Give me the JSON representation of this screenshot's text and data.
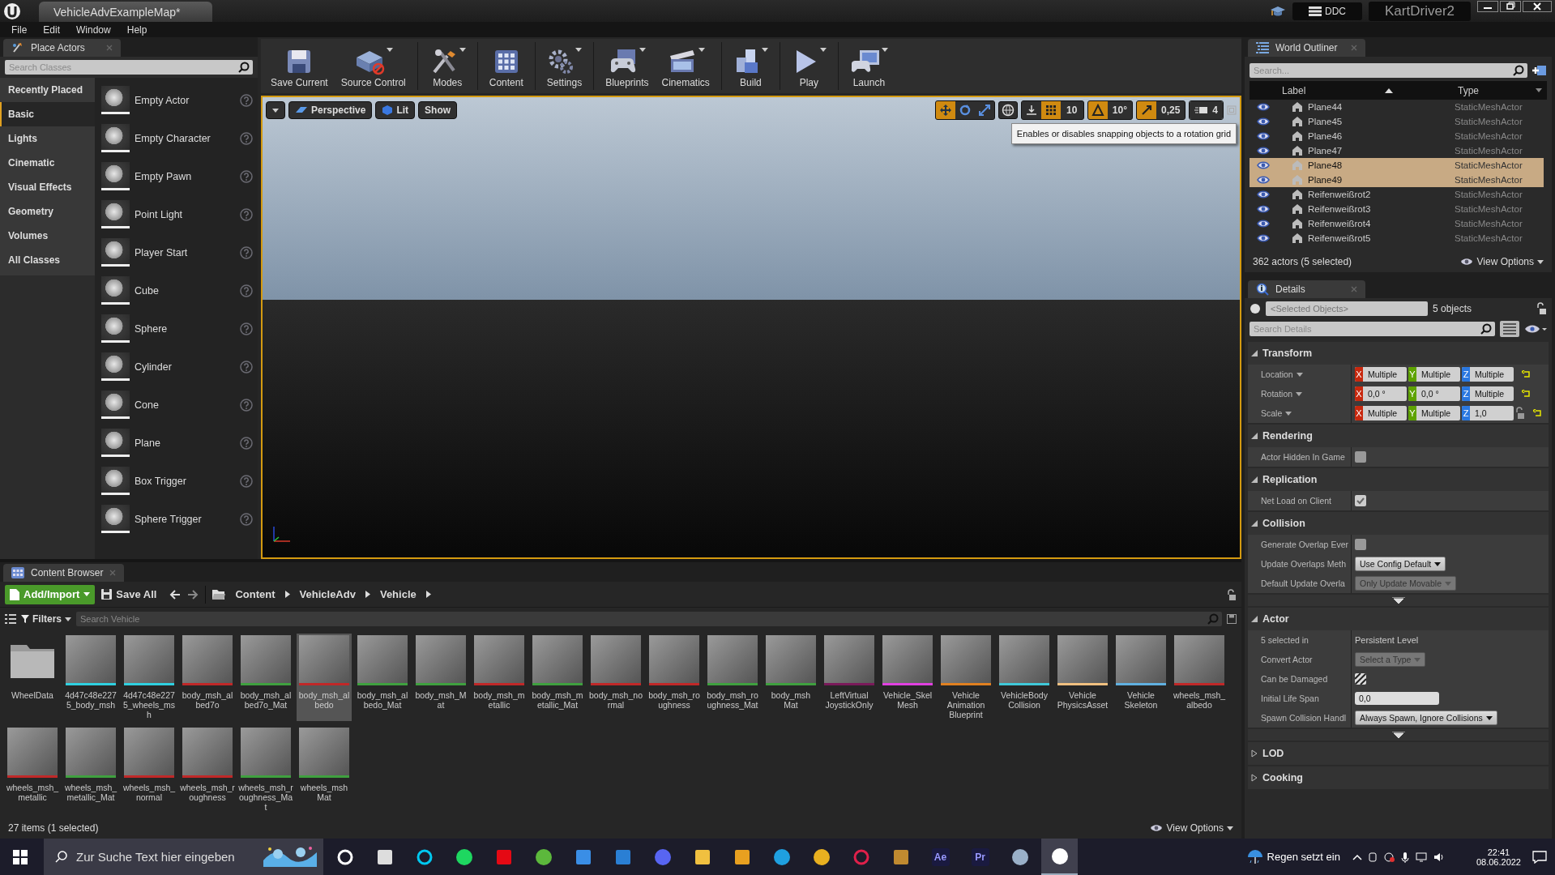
{
  "title_bar": {
    "document": "VehicleAdvExampleMap*",
    "ddc": "DDC",
    "project": "KartDriver2"
  },
  "menu": [
    "File",
    "Edit",
    "Window",
    "Help"
  ],
  "place_actors": {
    "title": "Place Actors",
    "search": {
      "placeholder": "Search Classes"
    },
    "categories": [
      {
        "label": "Recently Placed",
        "selected": false
      },
      {
        "label": "Basic",
        "selected": true
      },
      {
        "label": "Lights",
        "selected": false
      },
      {
        "label": "Cinematic",
        "selected": false
      },
      {
        "label": "Visual Effects",
        "selected": false
      },
      {
        "label": "Geometry",
        "selected": false
      },
      {
        "label": "Volumes",
        "selected": false
      },
      {
        "label": "All Classes",
        "selected": false
      }
    ],
    "items": [
      "Empty Actor",
      "Empty Character",
      "Empty Pawn",
      "Point Light",
      "Player Start",
      "Cube",
      "Sphere",
      "Cylinder",
      "Cone",
      "Plane",
      "Box Trigger",
      "Sphere Trigger"
    ]
  },
  "toolbar": [
    {
      "label": "Save Current",
      "dropdown": false
    },
    {
      "label": "Source Control",
      "dropdown": true
    },
    {
      "label": "Modes",
      "dropdown": true
    },
    {
      "label": "Content",
      "dropdown": false
    },
    {
      "label": "Settings",
      "dropdown": true
    },
    {
      "label": "Blueprints",
      "dropdown": true
    },
    {
      "label": "Cinematics",
      "dropdown": true
    },
    {
      "label": "Build",
      "dropdown": true
    },
    {
      "label": "Play",
      "dropdown": true
    },
    {
      "label": "Launch",
      "dropdown": true
    }
  ],
  "viewport": {
    "view_buttons": [
      "Perspective",
      "Lit",
      "Show"
    ],
    "transform_modes": [
      {
        "selected": true
      },
      {
        "selected": false
      },
      {
        "selected": false
      }
    ],
    "snaps": [
      {
        "value": "10",
        "on": true
      },
      {
        "value": "10°",
        "on": true
      },
      {
        "value": "0,25",
        "on": true
      }
    ],
    "camera_speed": "4",
    "tooltip": "Enables or disables snapping objects to a rotation grid"
  },
  "outliner": {
    "title": "World Outliner",
    "search": {
      "placeholder": "Search..."
    },
    "columns": [
      "Label",
      "Type"
    ],
    "rows": [
      {
        "label": "Plane44",
        "type": "StaticMeshActor",
        "selected": false
      },
      {
        "label": "Plane45",
        "type": "StaticMeshActor",
        "selected": false
      },
      {
        "label": "Plane46",
        "type": "StaticMeshActor",
        "selected": false
      },
      {
        "label": "Plane47",
        "type": "StaticMeshActor",
        "selected": false
      },
      {
        "label": "Plane48",
        "type": "StaticMeshActor",
        "selected": true
      },
      {
        "label": "Plane49",
        "type": "StaticMeshActor",
        "selected": true
      },
      {
        "label": "Reifenweißrot2",
        "type": "StaticMeshActor",
        "selected": false
      },
      {
        "label": "Reifenweißrot3",
        "type": "StaticMeshActor",
        "selected": false
      },
      {
        "label": "Reifenweißrot4",
        "type": "StaticMeshActor",
        "selected": false
      },
      {
        "label": "Reifenweißrot5",
        "type": "StaticMeshActor",
        "selected": false
      }
    ],
    "status": "362 actors (5 selected)",
    "view_options": "View Options"
  },
  "details": {
    "title": "Details",
    "selection": {
      "placeholder": "<Selected Objects>"
    },
    "count": "5 objects",
    "search": {
      "placeholder": "Search Details"
    },
    "sections": [
      {
        "title": "Transform",
        "expanded": true,
        "advanced": false,
        "rows": [
          {
            "kind": "vector",
            "label": "Location",
            "values": [
              {
                "axis": "X",
                "value": "Multiple"
              },
              {
                "axis": "Y",
                "value": "Multiple"
              },
              {
                "axis": "Z",
                "value": "Multiple"
              }
            ]
          },
          {
            "kind": "vector",
            "label": "Rotation",
            "values": [
              {
                "axis": "X",
                "value": "0,0 °"
              },
              {
                "axis": "Y",
                "value": "0,0 °"
              },
              {
                "axis": "Z",
                "value": "Multiple"
              }
            ]
          },
          {
            "kind": "vector",
            "label": "Scale",
            "values": [
              {
                "axis": "X",
                "value": "Multiple"
              },
              {
                "axis": "Y",
                "value": "Multiple"
              },
              {
                "axis": "Z",
                "value": "1,0"
              }
            ]
          }
        ]
      },
      {
        "title": "Rendering",
        "expanded": true,
        "advanced": false,
        "rows": [
          {
            "kind": "checkbox",
            "label": "Actor Hidden In Game",
            "checked": false,
            "mixed": false
          }
        ]
      },
      {
        "title": "Replication",
        "expanded": true,
        "advanced": false,
        "rows": [
          {
            "kind": "checkbox",
            "label": "Net Load on Client",
            "checked": true,
            "mixed": false
          }
        ]
      },
      {
        "title": "Collision",
        "expanded": true,
        "advanced": true,
        "rows": [
          {
            "kind": "checkbox",
            "label": "Generate Overlap Ever",
            "checked": false,
            "mixed": false
          },
          {
            "kind": "dropdown",
            "label": "Update Overlaps Meth",
            "value": "Use Config Default",
            "disabled": false
          },
          {
            "kind": "dropdown",
            "label": "Default Update Overla",
            "value": "Only Update Movable",
            "disabled": true
          }
        ]
      },
      {
        "title": "Actor",
        "expanded": true,
        "advanced": true,
        "rows": [
          {
            "kind": "text",
            "label": "5 selected in",
            "value": "Persistent Level"
          },
          {
            "kind": "dropdown",
            "label": "Convert Actor",
            "value": "Select a Type",
            "disabled": true
          },
          {
            "kind": "checkbox",
            "label": "Can be Damaged",
            "checked": true,
            "mixed": true
          },
          {
            "kind": "field",
            "label": "Initial Life Span",
            "value": "0,0"
          },
          {
            "kind": "dropdown",
            "label": "Spawn Collision Handl",
            "value": "Always Spawn, Ignore Collisions",
            "disabled": false
          }
        ]
      },
      {
        "title": "LOD",
        "expanded": false
      },
      {
        "title": "Cooking",
        "expanded": false
      }
    ]
  },
  "content_browser": {
    "title": "Content Browser",
    "add_button": "Add/Import",
    "save_button": "Save All",
    "path": [
      "Content",
      "VehicleAdv",
      "Vehicle"
    ],
    "filters": "Filters",
    "search": {
      "placeholder": "Search Vehicle"
    },
    "assets": [
      {
        "label": "WheelData",
        "kind": "folder",
        "selected": false
      },
      {
        "label": "4d47c48e2275_body_msh",
        "kind": "asset",
        "color": "#2fd0e0",
        "selected": false
      },
      {
        "label": "4d47c48e2275_wheels_msh",
        "kind": "asset",
        "color": "#2fd0e0",
        "selected": false
      },
      {
        "label": "body_msh_albed7o",
        "kind": "asset",
        "color": "#c02828",
        "selected": false
      },
      {
        "label": "body_msh_albed7o_Mat",
        "kind": "asset",
        "color": "#3fa03f",
        "selected": false
      },
      {
        "label": "body_msh_albedo",
        "kind": "asset",
        "color": "#c02828",
        "selected": true
      },
      {
        "label": "body_msh_albedo_Mat",
        "kind": "asset",
        "color": "#3fa03f",
        "selected": false
      },
      {
        "label": "body_msh_Mat",
        "kind": "asset",
        "color": "#3fa03f",
        "selected": false
      },
      {
        "label": "body_msh_metallic",
        "kind": "asset",
        "color": "#c02828",
        "selected": false
      },
      {
        "label": "body_msh_metallic_Mat",
        "kind": "asset",
        "color": "#3fa03f",
        "selected": false
      },
      {
        "label": "body_msh_normal",
        "kind": "asset",
        "color": "#c02828",
        "selected": false
      },
      {
        "label": "body_msh_roughness",
        "kind": "asset",
        "color": "#c02828",
        "selected": false
      },
      {
        "label": "body_msh_roughness_Mat",
        "kind": "asset",
        "color": "#3fa03f",
        "selected": false
      },
      {
        "label": "body_msh Mat",
        "kind": "asset",
        "color": "#3fa03f",
        "selected": false
      },
      {
        "label": "LeftVirtual JoystickOnly",
        "kind": "asset",
        "color": "#7a1a5a",
        "selected": false
      },
      {
        "label": "Vehicle_Skel Mesh",
        "kind": "asset",
        "color": "#e040e0",
        "selected": false
      },
      {
        "label": "Vehicle Animation Blueprint",
        "kind": "asset",
        "color": "#e08020",
        "selected": false
      },
      {
        "label": "VehicleBody Collision",
        "kind": "asset",
        "color": "#40c8d8",
        "selected": false
      },
      {
        "label": "Vehicle PhysicsAsset",
        "kind": "asset",
        "color": "#f0c080",
        "selected": false
      },
      {
        "label": "Vehicle Skeleton",
        "kind": "asset",
        "color": "#60b0e0",
        "selected": false
      },
      {
        "label": "wheels_msh_albedo",
        "kind": "asset",
        "color": "#c02828",
        "selected": false
      },
      {
        "label": "wheels_msh_metallic",
        "kind": "asset",
        "color": "#c02828",
        "selected": false
      },
      {
        "label": "wheels_msh_metallic_Mat",
        "kind": "asset",
        "color": "#3fa03f",
        "selected": false
      },
      {
        "label": "wheels_msh_normal",
        "kind": "asset",
        "color": "#c02828",
        "selected": false
      },
      {
        "label": "wheels_msh_roughness",
        "kind": "asset",
        "color": "#c02828",
        "selected": false
      },
      {
        "label": "wheels_msh_roughness_Mat",
        "kind": "asset",
        "color": "#3fa03f",
        "selected": false
      },
      {
        "label": "wheels_msh Mat",
        "kind": "asset",
        "color": "#3fa03f",
        "selected": false
      }
    ],
    "status": "27 items (1 selected)",
    "view_options": "View Options"
  },
  "taskbar": {
    "search": {
      "placeholder": "Zur Suche Text hier eingeben"
    },
    "apps": [
      {
        "kind": "ring",
        "color": "#ffffff",
        "selected": false
      },
      {
        "kind": "square",
        "color": "#dddddd",
        "selected": false
      },
      {
        "kind": "ring",
        "color": "#00c8f0",
        "selected": false
      },
      {
        "kind": "dot",
        "color": "#1ed760",
        "selected": false
      },
      {
        "kind": "square",
        "color": "#e50914",
        "selected": false
      },
      {
        "kind": "dot",
        "color": "#5cb83c",
        "selected": false
      },
      {
        "kind": "square",
        "color": "#3a8ee6",
        "selected": false
      },
      {
        "kind": "square",
        "color": "#2a7fd4",
        "selected": false
      },
      {
        "kind": "dot",
        "color": "#5865f2",
        "selected": false
      },
      {
        "kind": "square",
        "color": "#f0c040",
        "selected": false
      },
      {
        "kind": "square",
        "color": "#e8a020",
        "selected": false
      },
      {
        "kind": "dot",
        "color": "#1fa0e0",
        "selected": false
      },
      {
        "kind": "dot",
        "color": "#e8b020",
        "selected": false
      },
      {
        "kind": "ring",
        "color": "#e0204a",
        "selected": false
      },
      {
        "kind": "square",
        "color": "#c08a30",
        "selected": false
      },
      {
        "kind": "letter",
        "color": "#9999ff",
        "text": "Ae",
        "selected": false
      },
      {
        "kind": "letter",
        "color": "#9999ff",
        "text": "Pr",
        "selected": false
      },
      {
        "kind": "dot",
        "color": "#9ab0c8",
        "selected": false
      },
      {
        "kind": "dot",
        "color": "#ffffff",
        "selected": true
      }
    ],
    "weather": "Regen setzt ein",
    "time": "22:41",
    "date": "08.06.2022"
  }
}
